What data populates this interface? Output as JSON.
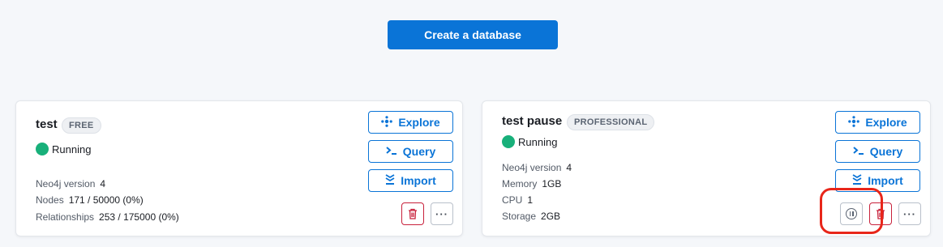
{
  "header": {
    "create_button_label": "Create a database"
  },
  "databases": [
    {
      "name": "test",
      "tier": "FREE",
      "status": "Running",
      "details": [
        {
          "label": "Neo4j version",
          "value": "4"
        },
        {
          "label": "Nodes",
          "value": "171 / 50000 (0%)"
        },
        {
          "label": "Relationships",
          "value": "253 / 175000 (0%)"
        }
      ],
      "actions": {
        "explore": "Explore",
        "query": "Query",
        "import": "Import",
        "more": "···"
      }
    },
    {
      "name": "test pause",
      "tier": "PROFESSIONAL",
      "status": "Running",
      "details": [
        {
          "label": "Neo4j version",
          "value": "4"
        },
        {
          "label": "Memory",
          "value": "1GB"
        },
        {
          "label": "CPU",
          "value": "1"
        },
        {
          "label": "Storage",
          "value": "2GB"
        }
      ],
      "actions": {
        "explore": "Explore",
        "query": "Query",
        "import": "Import",
        "more": "···"
      }
    }
  ],
  "colors": {
    "accent": "#0a74d7",
    "running": "#18b07a",
    "delete": "#c8213b",
    "highlight": "#e8261a"
  },
  "icons": {
    "explore": "explore-icon",
    "query": "terminal-icon",
    "import": "import-icon",
    "delete": "trash-icon",
    "pause": "pause-icon",
    "more": "more-icon"
  }
}
